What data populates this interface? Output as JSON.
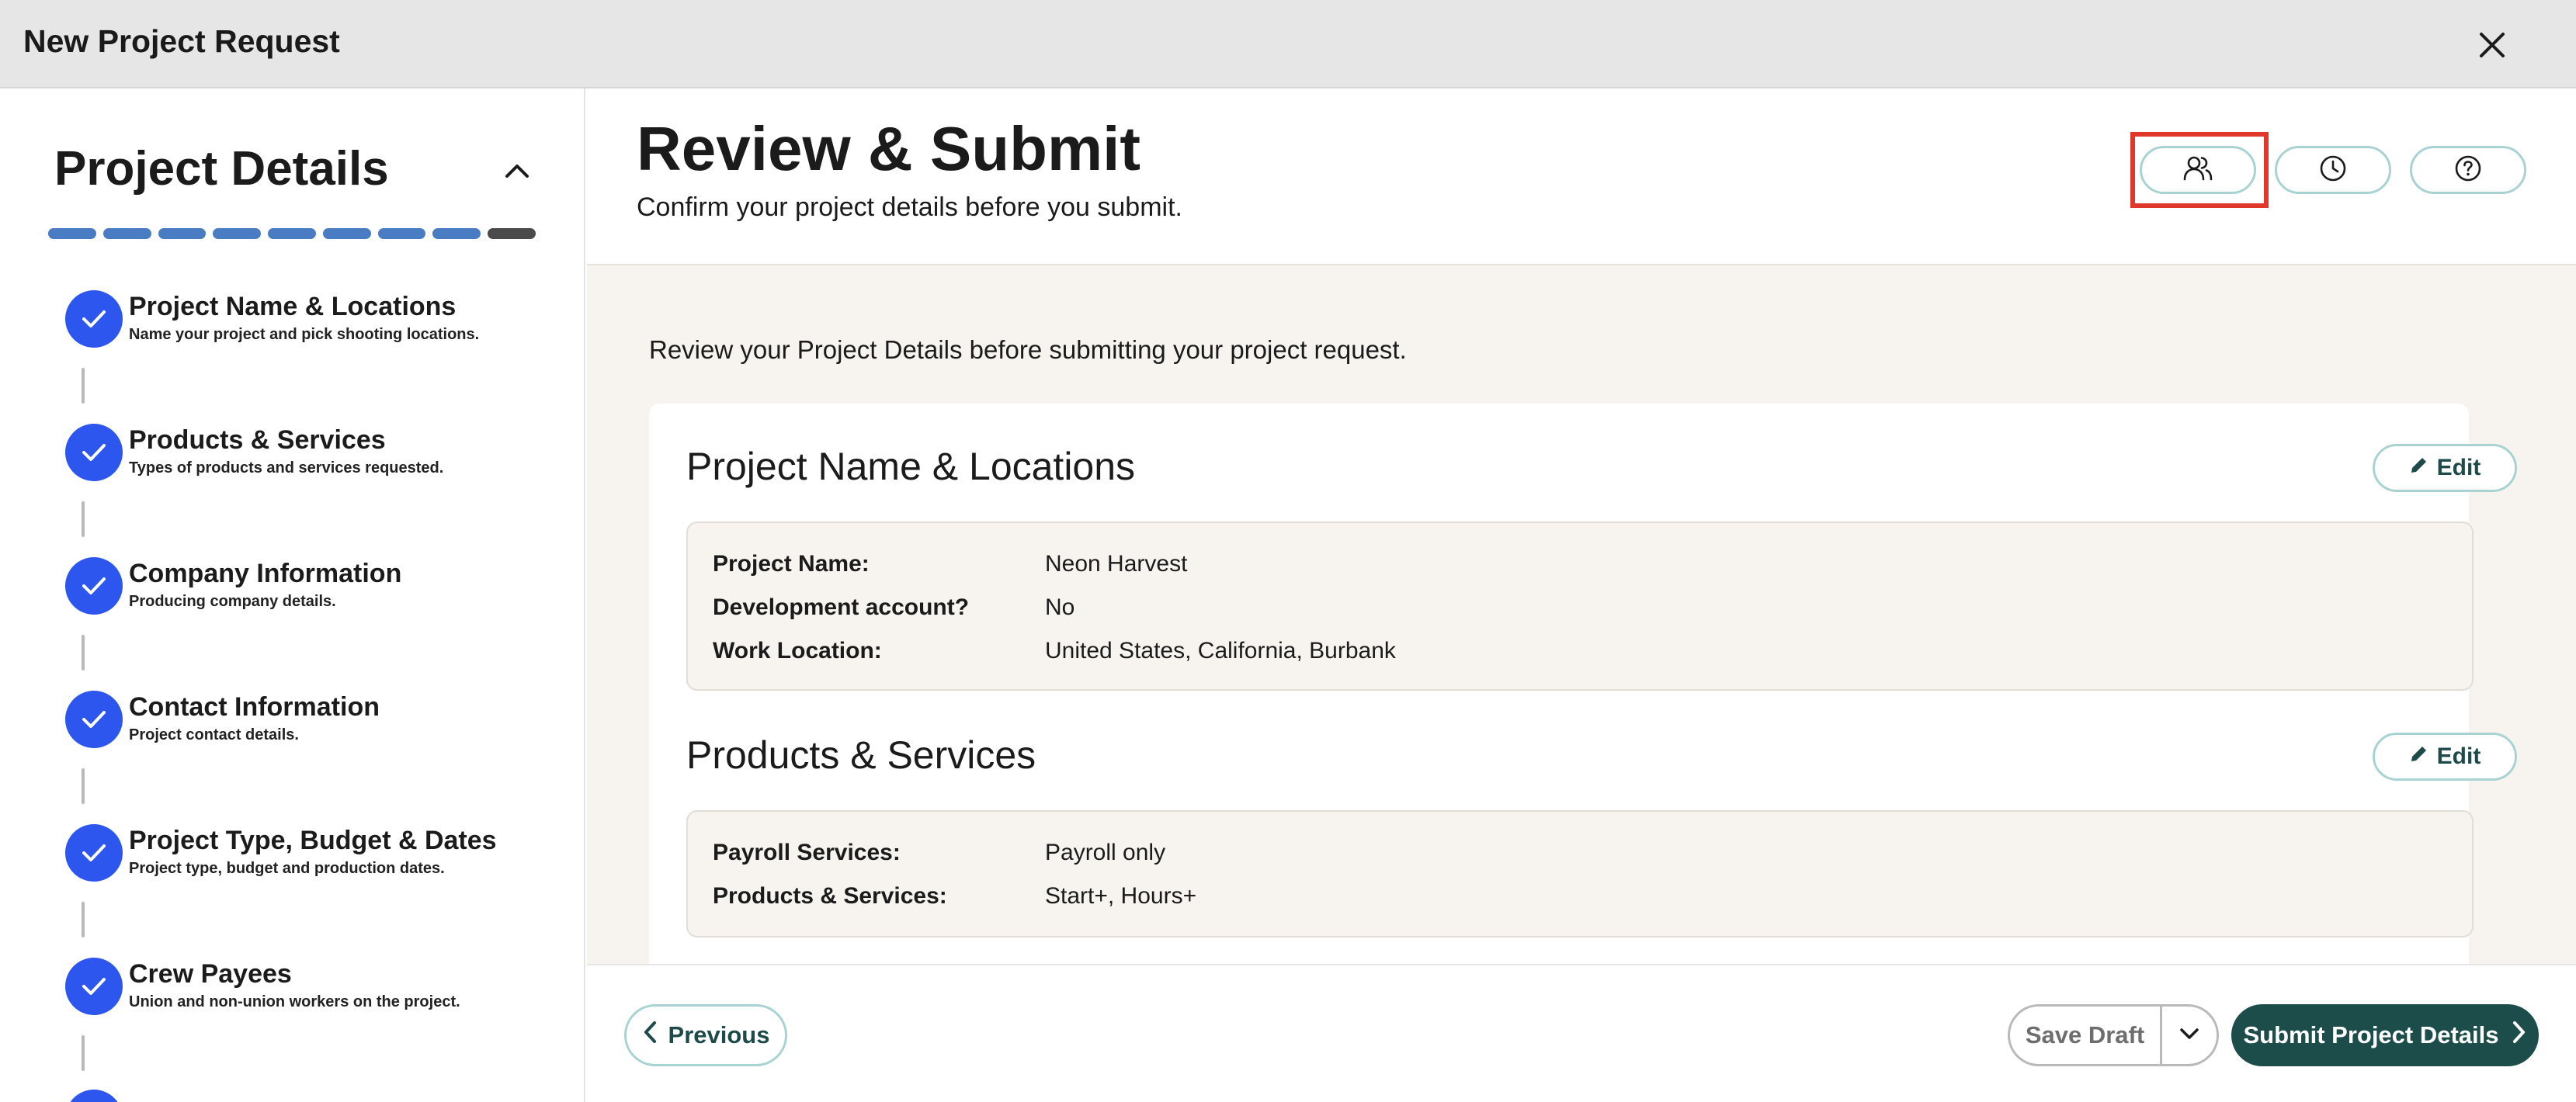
{
  "window": {
    "title": "New Project Request",
    "close_icon": "close-icon"
  },
  "sidebar": {
    "heading": "Project Details",
    "progress": {
      "total_steps": 9,
      "completed_steps": 8
    },
    "steps": [
      {
        "title": "Project Name & Locations",
        "description": "Name your project and pick shooting locations.",
        "status": "complete"
      },
      {
        "title": "Products & Services",
        "description": "Types of products and services requested.",
        "status": "complete"
      },
      {
        "title": "Company Information",
        "description": "Producing company details.",
        "status": "complete"
      },
      {
        "title": "Contact Information",
        "description": "Project contact details.",
        "status": "complete"
      },
      {
        "title": "Project Type, Budget & Dates",
        "description": "Project type, budget and production dates.",
        "status": "complete"
      },
      {
        "title": "Crew Payees",
        "description": "Union and non-union workers on the project.",
        "status": "complete"
      }
    ]
  },
  "header": {
    "title": "Review & Submit",
    "subtitle": "Confirm your project details before you submit.",
    "icons": [
      "people-icon",
      "clock-icon",
      "help-icon"
    ]
  },
  "content": {
    "intro": "Review your Project Details before submitting your project request.",
    "sections": [
      {
        "title": "Project Name & Locations",
        "edit_label": "Edit",
        "rows": [
          {
            "label": "Project Name:",
            "value": "Neon Harvest"
          },
          {
            "label": "Development account?",
            "value": "No"
          },
          {
            "label": "Work Location:",
            "value": "United States, California, Burbank"
          }
        ]
      },
      {
        "title": "Products & Services",
        "edit_label": "Edit",
        "rows": [
          {
            "label": "Payroll Services:",
            "value": "Payroll only"
          },
          {
            "label": "Products & Services:",
            "value": "Start+, Hours+"
          }
        ]
      }
    ]
  },
  "footer": {
    "previous_label": "Previous",
    "save_draft_label": "Save Draft",
    "submit_label": "Submit Project Details"
  },
  "colors": {
    "accent_blue": "#2d56ee",
    "progress_blue": "#4a7cc4",
    "teal_dark": "#1d4d4a",
    "teal_border": "#a9d2d2",
    "highlight_red": "#e0392b",
    "content_bg": "#f7f4f0"
  }
}
